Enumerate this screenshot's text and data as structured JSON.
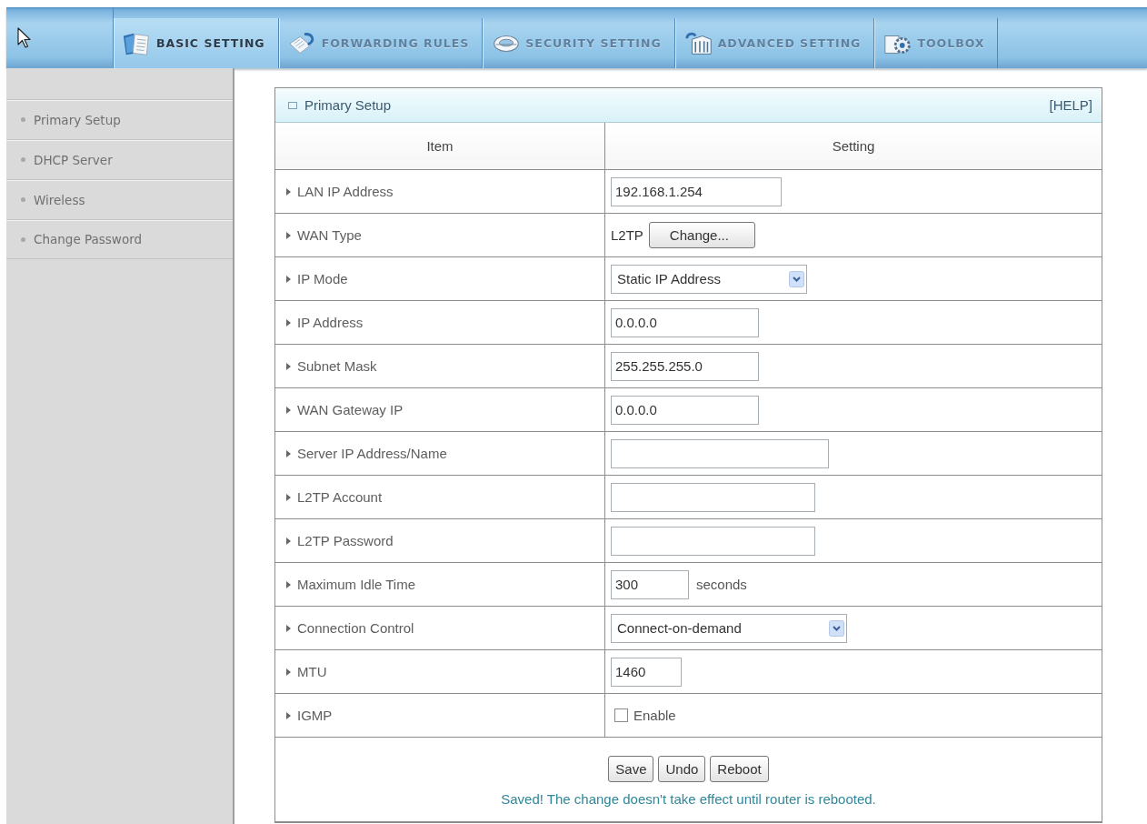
{
  "toolbar": {
    "tabs": [
      {
        "label": "BASIC SETTING",
        "selected": true
      },
      {
        "label": "FORWARDING RULES",
        "selected": false
      },
      {
        "label": "SECURITY SETTING",
        "selected": false
      },
      {
        "label": "ADVANCED SETTING",
        "selected": false
      },
      {
        "label": "TOOLBOX",
        "selected": false
      }
    ]
  },
  "sidebar": {
    "items": [
      {
        "label": "Primary Setup"
      },
      {
        "label": "DHCP Server"
      },
      {
        "label": "Wireless"
      },
      {
        "label": "Change Password"
      }
    ]
  },
  "panel": {
    "title": "Primary Setup",
    "help": "[HELP]",
    "columns": [
      "Item",
      "Setting"
    ],
    "rows": [
      {
        "label": "LAN IP Address",
        "kind": "input",
        "value": "192.168.1.254"
      },
      {
        "label": "WAN Type",
        "kind": "text_button",
        "text": "L2TP",
        "button": "Change..."
      },
      {
        "label": "IP Mode",
        "kind": "select",
        "value": "Static IP Address"
      },
      {
        "label": "IP Address",
        "kind": "input",
        "value": "0.0.0.0"
      },
      {
        "label": "Subnet Mask",
        "kind": "input",
        "value": "255.255.255.0"
      },
      {
        "label": "WAN Gateway IP",
        "kind": "input",
        "value": "0.0.0.0"
      },
      {
        "label": "Server IP Address/Name",
        "kind": "input"
      },
      {
        "label": "L2TP Account",
        "kind": "input"
      },
      {
        "label": "L2TP Password",
        "kind": "input"
      },
      {
        "label": "Maximum Idle Time",
        "kind": "input",
        "value": "300",
        "unit": "seconds"
      },
      {
        "label": "Connection Control",
        "kind": "select",
        "value": "Connect-on-demand"
      },
      {
        "label": "MTU",
        "kind": "input",
        "value": "1460"
      },
      {
        "label": "IGMP",
        "kind": "checkbox",
        "checked": false,
        "option": "Enable"
      }
    ],
    "buttons": [
      "Save",
      "Undo",
      "Reboot"
    ],
    "message": "Saved! The change doesn't take effect until router is rebooted."
  }
}
